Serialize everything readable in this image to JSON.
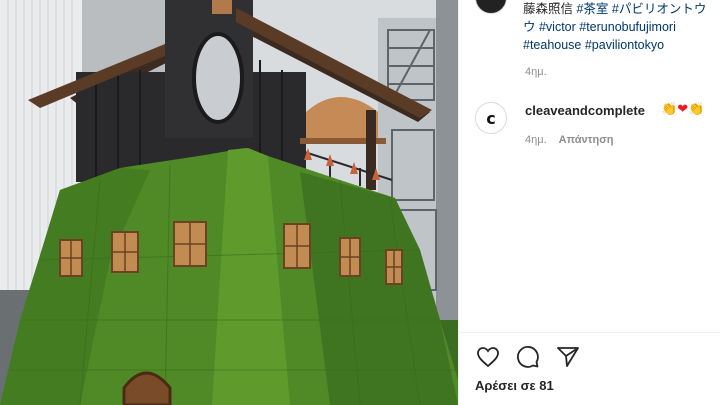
{
  "post": {
    "caption": {
      "line1_text": "藤森照信 ",
      "line1_tag": "#茶室 #パビリオントウ",
      "line2_tag": "ウ #victor #terunobufujimori",
      "line3_tag": "#teahouse #paviliontokyo"
    },
    "caption_time": "4ημ."
  },
  "comment": {
    "avatar_glyph": "c",
    "username": "cleaveandcomplete",
    "emoji_1": "👏",
    "emoji_2": "❤",
    "emoji_3": "👏",
    "time": "4ημ.",
    "reply_label": "Απάντηση"
  },
  "actions": {
    "icons": [
      "heart-icon",
      "comment-icon",
      "share-icon"
    ],
    "likes_text": "Αρέσει σε 81"
  },
  "colors": {
    "text": "#262626",
    "secondary": "#8e8e8e",
    "hashtag": "#00376b",
    "moss": "#4f8a26"
  }
}
